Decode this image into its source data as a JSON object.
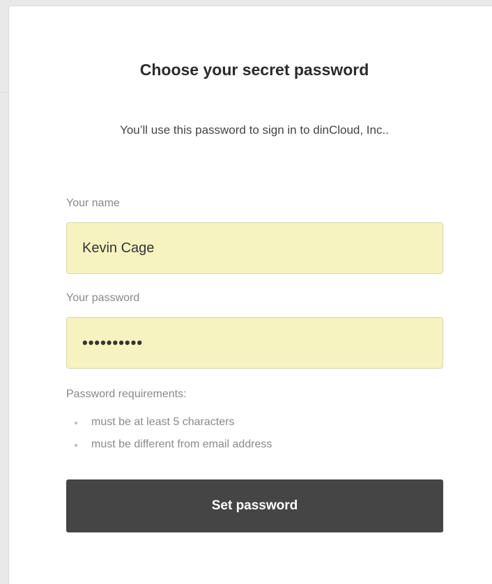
{
  "form": {
    "title": "Choose your secret password",
    "subtitle": "You’ll use this password to sign in to dinCloud, Inc..",
    "name_label": "Your name",
    "name_value": "Kevin Cage",
    "password_label": "Your password",
    "password_value": "••••••••••",
    "requirements_heading": "Password requirements:",
    "requirements": [
      "must be at least 5 characters",
      "must be different from email address"
    ],
    "submit_label": "Set password"
  },
  "colors": {
    "field_background": "#f6f3c0",
    "button_background": "#454545",
    "page_background": "#e9e9e9"
  }
}
